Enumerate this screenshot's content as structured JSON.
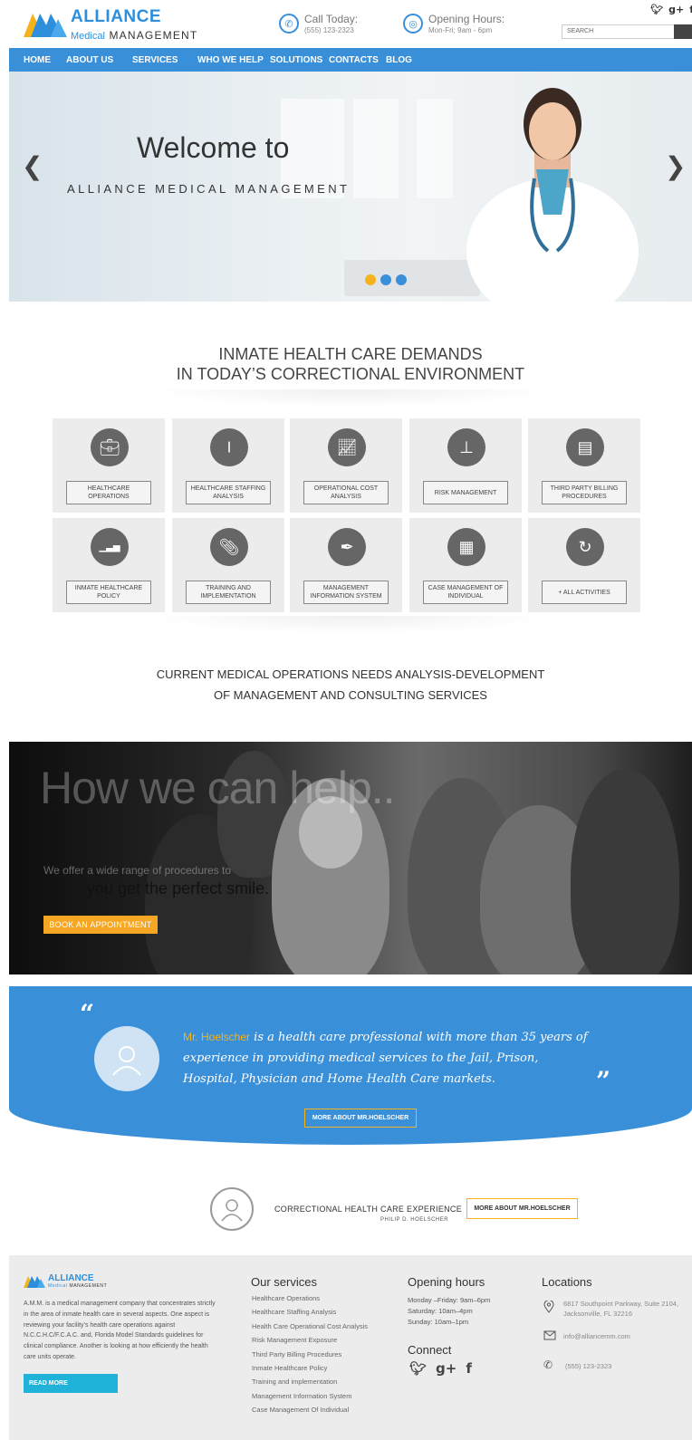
{
  "header": {
    "logo_line1": "ALLIANCE",
    "logo_line2_a": "Medical",
    "logo_line2_b": "MANAGEMENT",
    "call_label": "Call Today:",
    "call_value": "(555) 123-2323",
    "hours_label": "Opening Hours:",
    "hours_value": "Mon-Fri; 9am - 6pm",
    "search_placeholder": "SEARCH",
    "social": [
      "twitter",
      "google-plus",
      "facebook"
    ]
  },
  "nav": {
    "items": [
      "HOME",
      "ABOUT US",
      "SERVICES",
      "WHO WE HELP",
      "SOLUTIONS",
      "CONTACTS",
      "BLOG"
    ]
  },
  "hero": {
    "title": "Welcome to",
    "subtitle": "ALLIANCE MEDICAL MANAGEMENT",
    "prev": "❮",
    "next": "❯",
    "slides": 3,
    "active_slide": 1
  },
  "demands": {
    "line1": "INMATE HEALTH CARE DEMANDS",
    "line2": "IN TODAY’S CORRECTIONAL ENVIRONMENT"
  },
  "services": [
    {
      "label": "HEALTHCARE OPERATIONS",
      "icon": "briefcase-icon"
    },
    {
      "label": "HEALTHCARE STAFFING ANALYSIS",
      "icon": "candlestick-chart-icon"
    },
    {
      "label": "OPERATIONAL COST ANALYSIS",
      "icon": "line-chart-icon"
    },
    {
      "label": "RISK MANAGEMENT",
      "icon": "stamp-icon"
    },
    {
      "label": "THIRD PARTY BILLING PROCEDURES",
      "icon": "invoice-icon"
    },
    {
      "label": "INMATE HEALTHCARE POLICY",
      "icon": "bar-chart-icon"
    },
    {
      "label": "TRAINING AND IMPLEMENTATION",
      "icon": "paperclip-icon"
    },
    {
      "label": "MANAGEMENT INFORMATION SYSTEM",
      "icon": "pen-nib-icon"
    },
    {
      "label": "CASE MANAGEMENT OF INDIVIDUAL",
      "icon": "calendar-icon"
    },
    {
      "label": "+ ALL ACTIVITIES",
      "icon": "all-icon"
    }
  ],
  "current": {
    "line1": "CURRENT MEDICAL OPERATIONS NEEDS ANALYSIS-DEVELOPMENT",
    "line2": "OF MANAGEMENT AND CONSULTING SERVICES"
  },
  "help": {
    "title": "How we can help..",
    "line1": "We offer a wide range of procedures to",
    "line2": "you get the perfect smile.",
    "button": "BOOK AN APPOINTMENT"
  },
  "testimonial": {
    "name": "Mr. Hoelscher",
    "text": " is a health care professional with more than 35 years of experience in providing medical services to the Jail, Prison, Hospital, Physician and Home Health Care markets.",
    "button": "MORE ABOUT MR.HOELSCHER",
    "quote_open": "“",
    "quote_close": "”"
  },
  "experience": {
    "title": "CORRECTIONAL HEALTH CARE EXPERIENCE",
    "sub": "PHILIP D. HOELSCHER",
    "button": "MORE ABOUT MR.HOELSCHER"
  },
  "footer": {
    "about": "A.M.M. is a medical management company that concentrates strictly in the area of inmate health care in several aspects. One aspect is reviewing your facility’s health care operations against N.C.C.H.C/F.C.A.C. and, Florida Model Standards guidelines for clinical compliance. Another is looking at how efficiently the health care units operate.",
    "read_more": "READ MORE",
    "services_title": "Our services",
    "services": [
      "Healthcare Operations",
      "Healthcare Staffing Analysis",
      "Health Care Operational Cost Analysis",
      "Risk Management Exposure",
      "Third Party Billing Procedures",
      "Inmate Healthcare Policy",
      "Training and implementation",
      "Management Information System",
      "Case Management Of Individual"
    ],
    "hours_title": "Opening hours",
    "hours": [
      "Monday –Friday: 9am–6pm",
      "Saturday: 10am–4pm",
      "Sunday: 10am–1pm"
    ],
    "connect_title": "Connect",
    "locations_title": "Locations",
    "address1": "6817 Southpoint Parkway, Suite 2104,",
    "address2": "Jacksonville, FL 32216",
    "email": "info@alliancemm.com",
    "phone": "(555) 123-2323"
  },
  "colors": {
    "brand_blue": "#3a8fd9",
    "accent_orange": "#f5a623",
    "accent_yellow": "#f5b21a",
    "cyan": "#1fb3d9"
  }
}
